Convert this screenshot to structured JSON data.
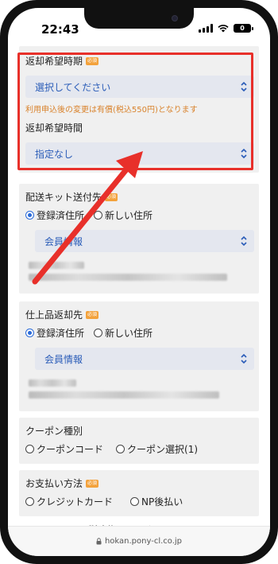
{
  "status_bar": {
    "time": "22:43",
    "battery": "0"
  },
  "form": {
    "return_date": {
      "label": "返却希望時期",
      "required": "必須",
      "select_value": "選択してください",
      "note": "利用申込後の変更は有償(税込550円)となります"
    },
    "return_time": {
      "label": "返却希望時間",
      "select_value": "指定なし"
    },
    "kit_shipping": {
      "label": "配送キット送付先",
      "required": "必須",
      "options": [
        "登録済住所",
        "新しい住所"
      ],
      "selected": "登録済住所",
      "select_value": "会員情報"
    },
    "finished_return": {
      "label": "仕上品返却先",
      "required": "必須",
      "options": [
        "登録済住所",
        "新しい住所"
      ],
      "selected": "登録済住所",
      "select_value": "会員情報"
    },
    "coupon": {
      "label": "クーポン種別",
      "options": [
        "クーポンコード",
        "クーポン選択(1)"
      ]
    },
    "payment": {
      "label": "お支払い方法",
      "required": "必須",
      "options": [
        "クレジットカード",
        "NP後払い"
      ]
    },
    "cancel_link": "ご注文後のキャンセルについて"
  },
  "url_bar": {
    "domain": "hokan.pony-cl.co.jp"
  },
  "colors": {
    "highlight": "#e8302a",
    "accent_blue": "#2a5cb8",
    "note_orange": "#d9822b",
    "badge": "#f3a23c"
  }
}
